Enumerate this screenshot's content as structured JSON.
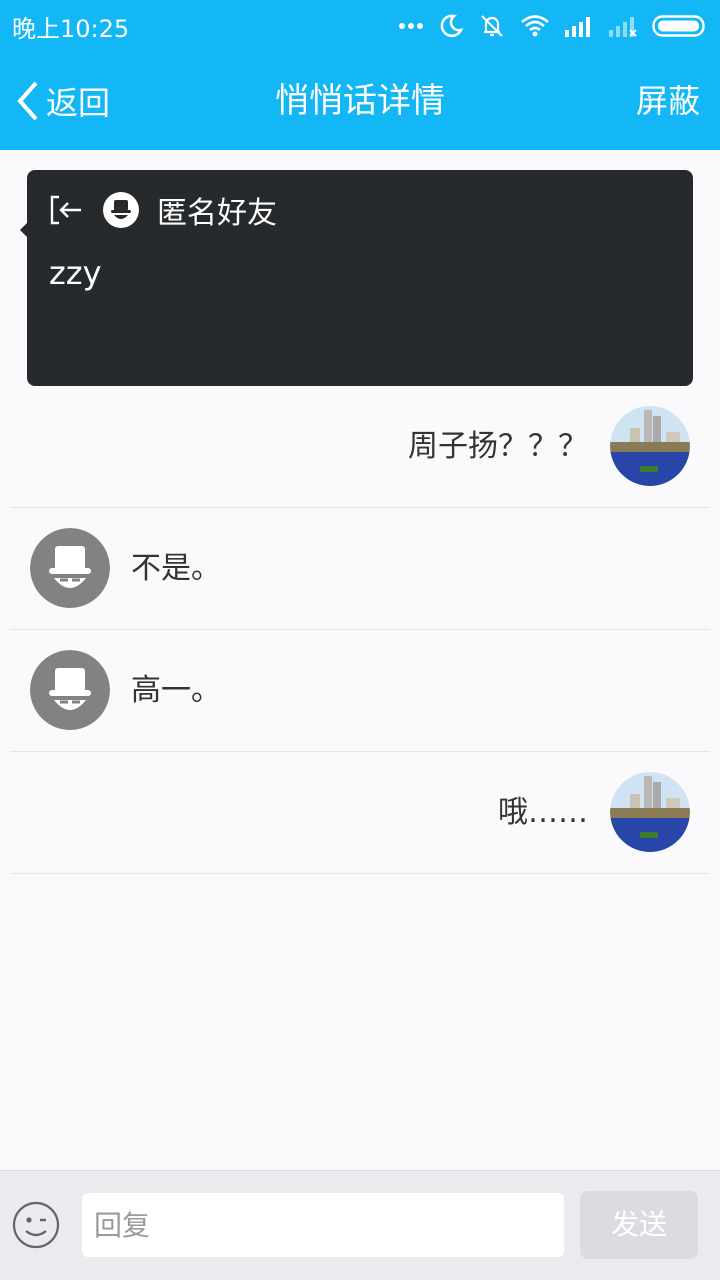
{
  "status_bar": {
    "time": "晚上10:25",
    "icons": [
      "more-dots-icon",
      "moon-icon",
      "mute-icon",
      "wifi-icon",
      "signal-icon",
      "no-signal-icon",
      "battery-icon"
    ]
  },
  "nav": {
    "back_label": "返回",
    "title": "悄悄话详情",
    "right_label": "屏蔽"
  },
  "post": {
    "author": "匿名好友",
    "content": "zzy"
  },
  "messages": [
    {
      "side": "right",
      "text": "周子扬？？？",
      "avatar": "user-avatar"
    },
    {
      "side": "left",
      "text": "不是。",
      "avatar": "anonymous-avatar"
    },
    {
      "side": "left",
      "text": "高一。",
      "avatar": "anonymous-avatar"
    },
    {
      "side": "right",
      "text": "哦……",
      "avatar": "user-avatar"
    }
  ],
  "footer": {
    "input_placeholder": "回复",
    "send_label": "发送"
  },
  "colors": {
    "accent": "#13b7f5",
    "card_bg": "#262a2d",
    "page_bg": "#fafafc",
    "send_disabled": "#dcdce0"
  }
}
